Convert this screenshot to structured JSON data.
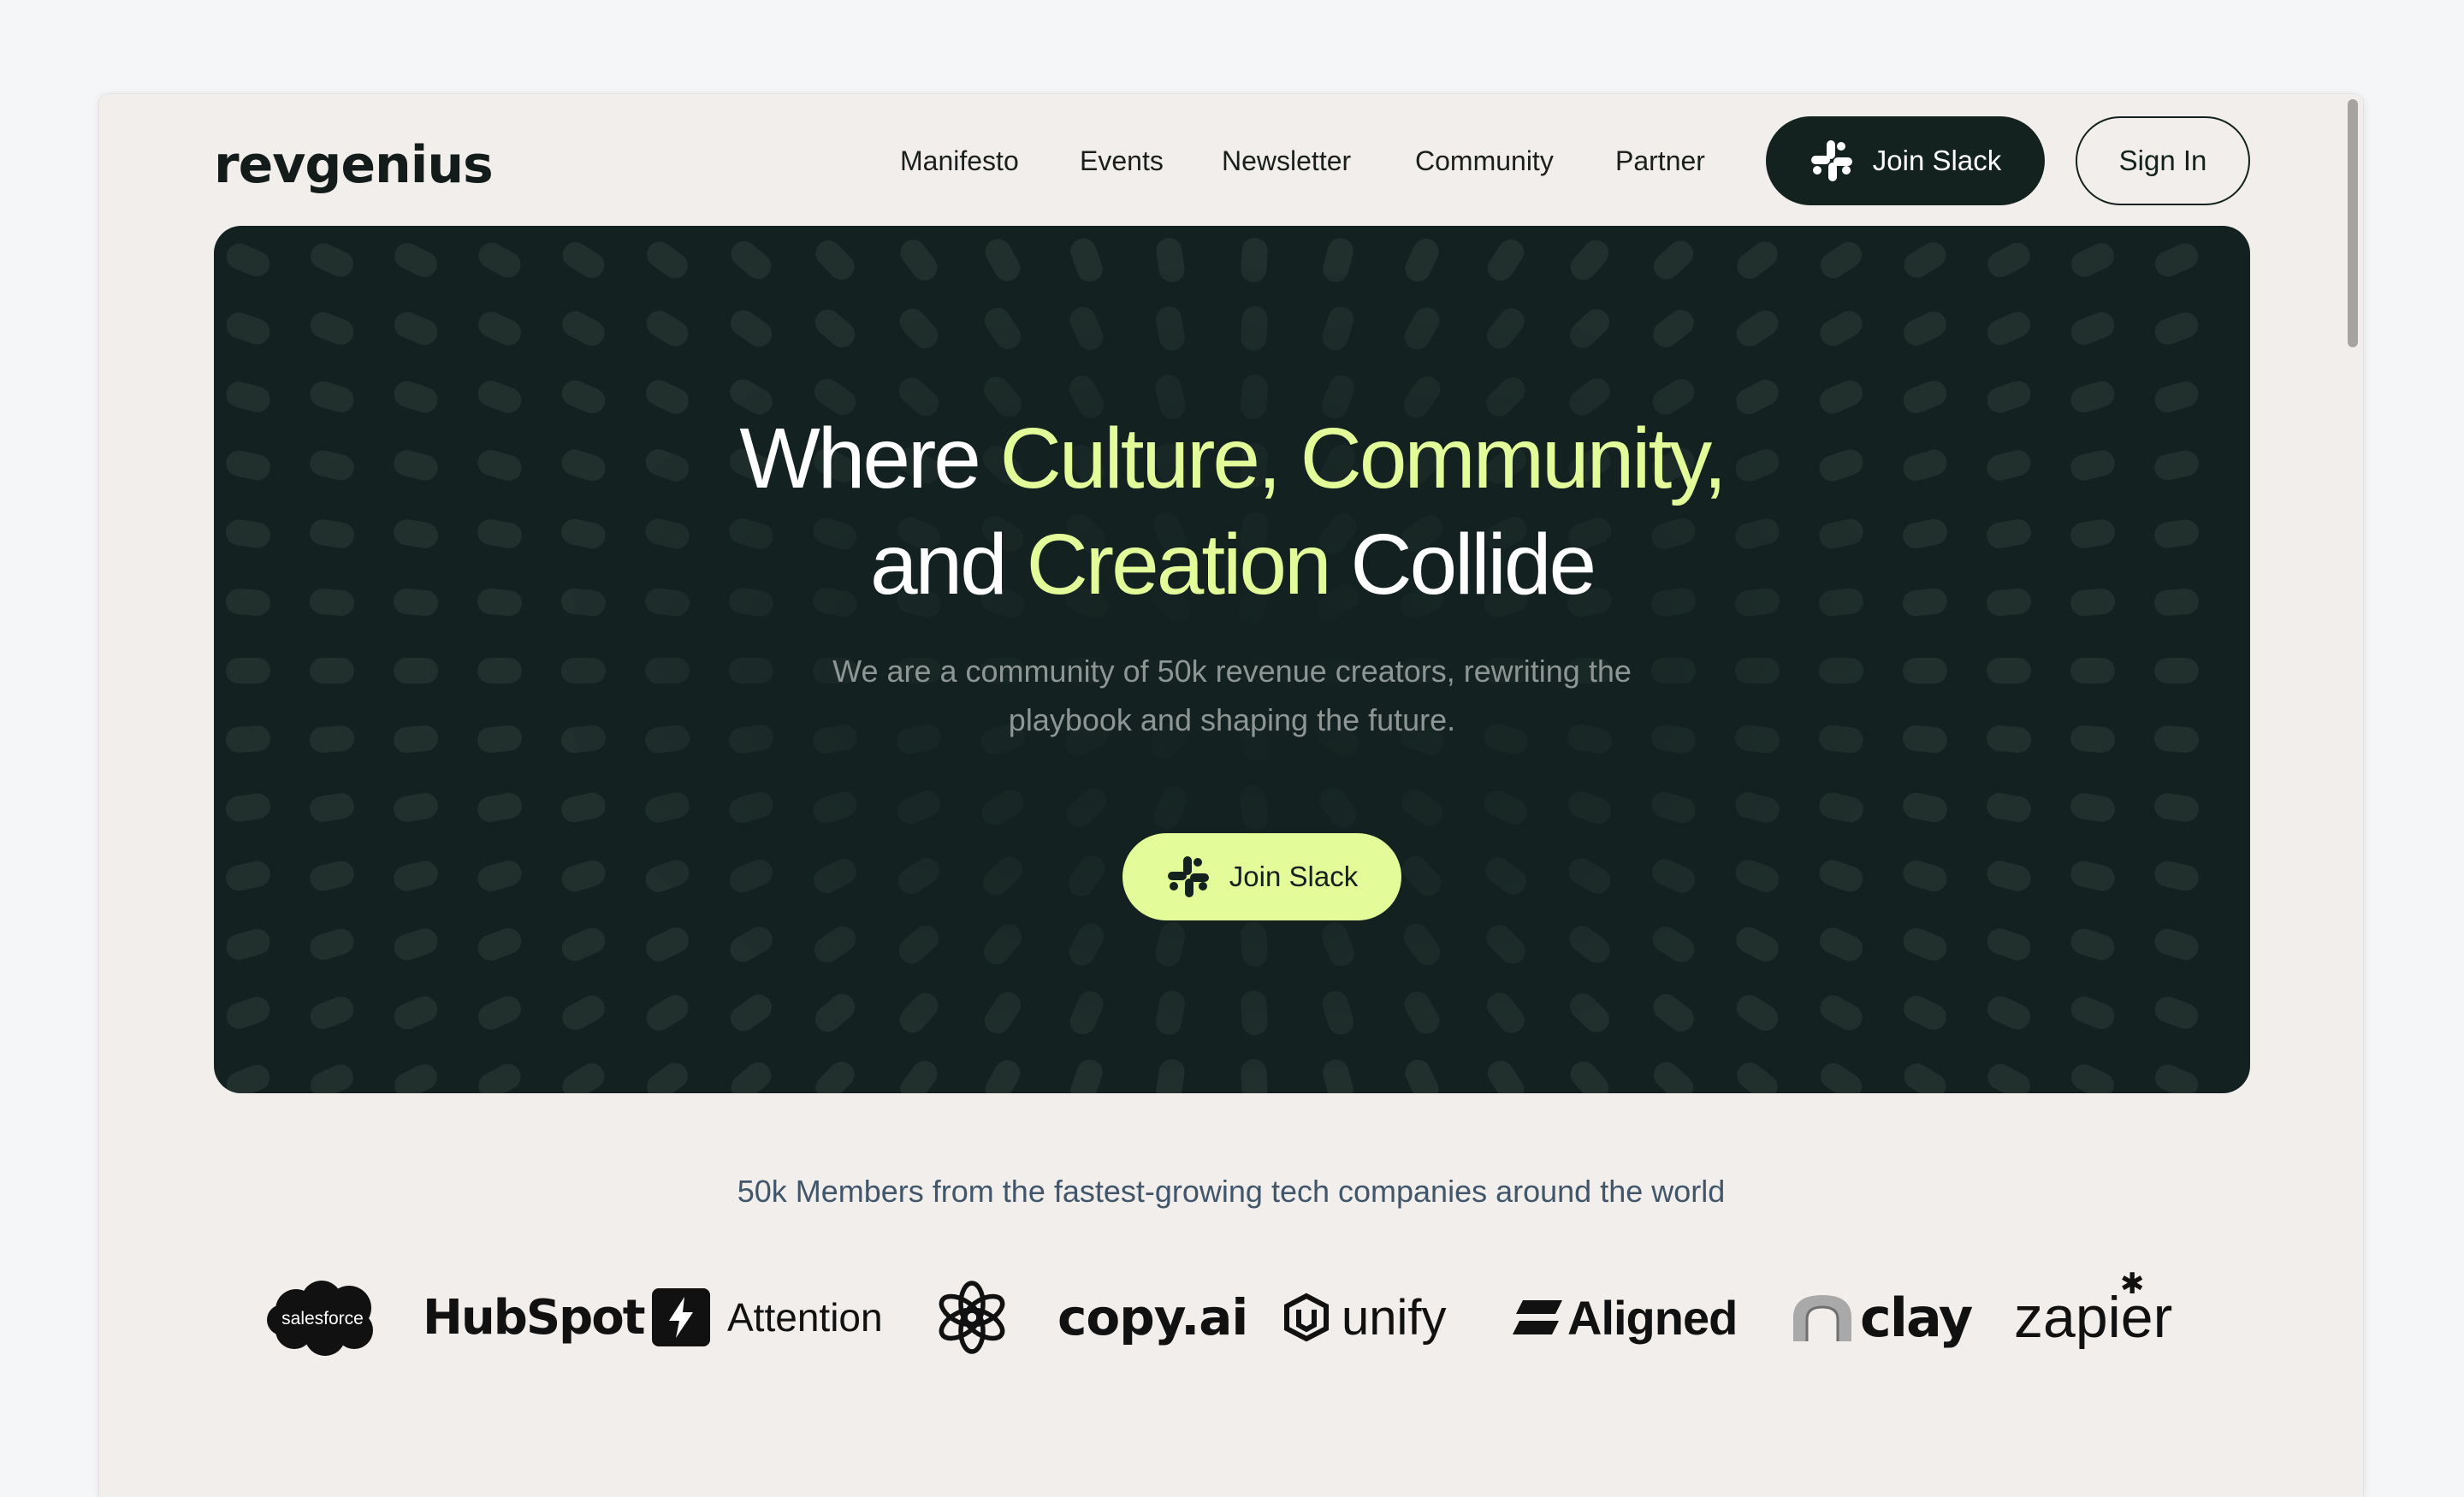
{
  "header": {
    "logo_text": "revgenius",
    "nav": [
      "Manifesto",
      "Events",
      "Newsletter",
      "Community",
      "Partner"
    ],
    "join_slack_label": "Join Slack",
    "sign_in_label": "Sign In"
  },
  "hero": {
    "title": {
      "w1": "Where ",
      "w2": "Culture, Community,",
      "w3": "and ",
      "w4": "Creation",
      "w5": " Collide"
    },
    "subtitle_line1": "We are a community of 50k revenue creators, rewriting the",
    "subtitle_line2": "playbook and shaping the future.",
    "cta_label": "Join Slack"
  },
  "social_proof": {
    "tagline": "50k Members from the fastest-growing tech companies around the world",
    "logos": {
      "salesforce": "salesforce",
      "hubspot": "HubSpot",
      "attention": "Attention",
      "openai": "OpenAI",
      "copyai": "copy.ai",
      "unify": "unify",
      "aligned": "Aligned",
      "clay": "clay",
      "zapier": "zapier"
    }
  },
  "colors": {
    "page_bg": "#f1eeeb",
    "hero_bg": "#132220",
    "accent": "#e4fb9a",
    "dark_button": "#13211f",
    "tagline": "#41566a"
  },
  "icons": {
    "slack": "slack-icon",
    "attention": "lightning-bolt-icon",
    "openai": "openai-knot-icon",
    "unify": "hexagon-shield-icon",
    "aligned": "double-stripe-icon",
    "clay": "clay-arch-icon"
  }
}
